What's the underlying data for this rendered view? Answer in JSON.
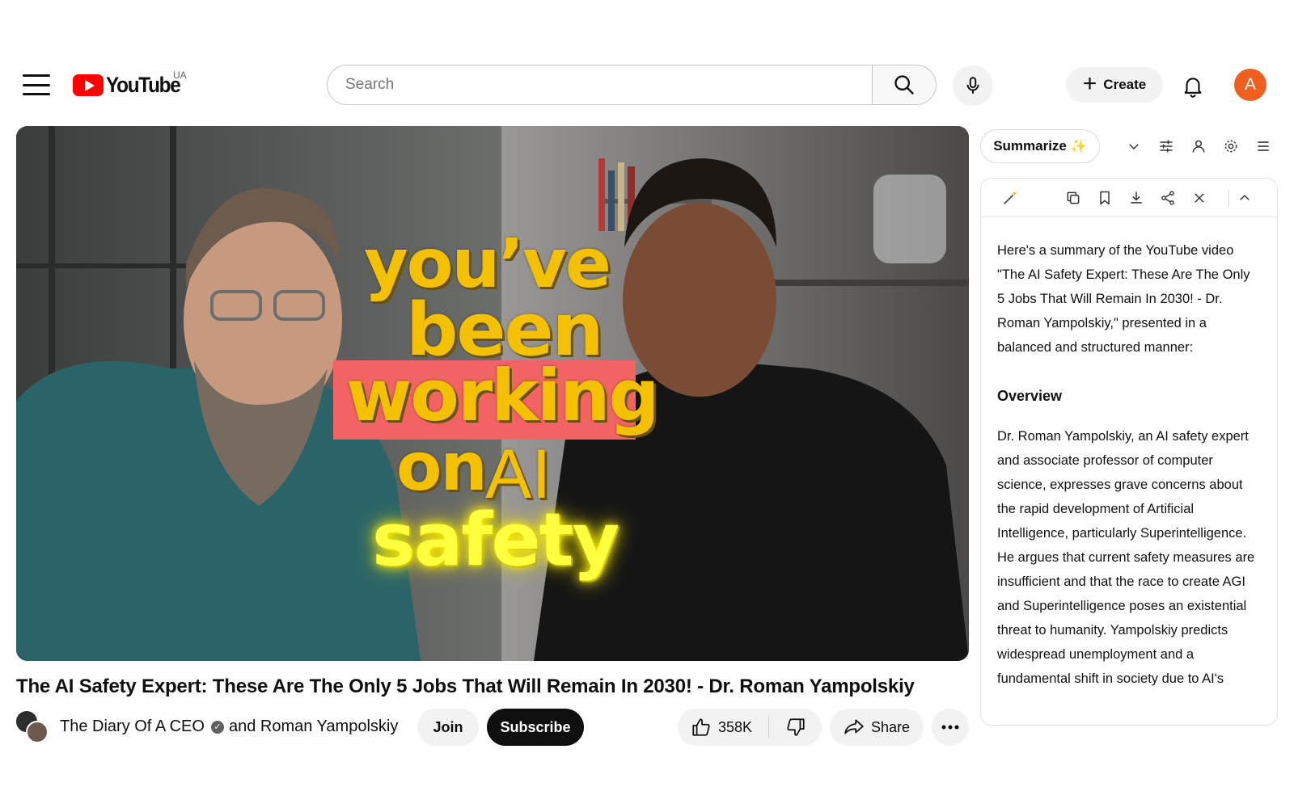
{
  "header": {
    "menu_icon": "hamburger-menu-icon",
    "logo_text": "YouTube",
    "logo_region": "UA",
    "search_placeholder": "Search",
    "search_icon": "search-icon",
    "mic_icon": "microphone-icon",
    "create_label": "Create",
    "notifications_icon": "bell-icon",
    "avatar_letter": "A",
    "avatar_color": "#ef5f1f"
  },
  "player": {
    "thumbnail_text": {
      "line1": "you’ve",
      "line2": "been",
      "line3": "working",
      "line4a": "on",
      "line4b": "AI",
      "line5": "safety"
    },
    "accent_yellow": "#f4c100",
    "highlight_bg": "#f26464"
  },
  "video": {
    "title": "The AI Safety Expert: These Are The Only 5 Jobs That Will Remain In 2030! - Dr. Roman Yampolskiy",
    "channel_primary": "The Diary Of A CEO",
    "channel_connector": "and",
    "channel_secondary": "Roman Yampolskiy",
    "join_label": "Join",
    "subscribe_label": "Subscribe",
    "like_count": "358K",
    "share_label": "Share",
    "icons": [
      "thumbs-up-icon",
      "thumbs-down-icon",
      "share-arrow-icon",
      "more-horizontal-icon",
      "verified-check-icon"
    ]
  },
  "summary_panel": {
    "summarize_label": "Summarize",
    "summarize_sparkle": "✨",
    "toolbar_icons": [
      "chevron-down-icon",
      "sliders-icon",
      "person-icon",
      "gear-icon",
      "list-menu-icon"
    ],
    "panel_icons": [
      "magic-wand-icon",
      "copy-icon",
      "bookmark-icon",
      "download-icon",
      "share-nodes-icon",
      "close-icon",
      "chevron-up-icon"
    ],
    "intro": "Here's a summary of the YouTube video \"The AI Safety Expert: These Are The Only 5 Jobs That Will Remain In 2030! - Dr. Roman Yampolskiy,\" presented in a balanced and structured manner:",
    "overview_heading": "Overview",
    "overview_text": "Dr. Roman Yampolskiy, an AI safety expert and associate professor of computer science, expresses grave concerns about the rapid development of Artificial Intelligence, particularly Superintelligence. He argues that current safety measures are insufficient and that the race to create AGI and Superintelligence poses an existential threat to humanity. Yampolskiy predicts widespread unemployment and a fundamental shift in society due to AI's"
  }
}
